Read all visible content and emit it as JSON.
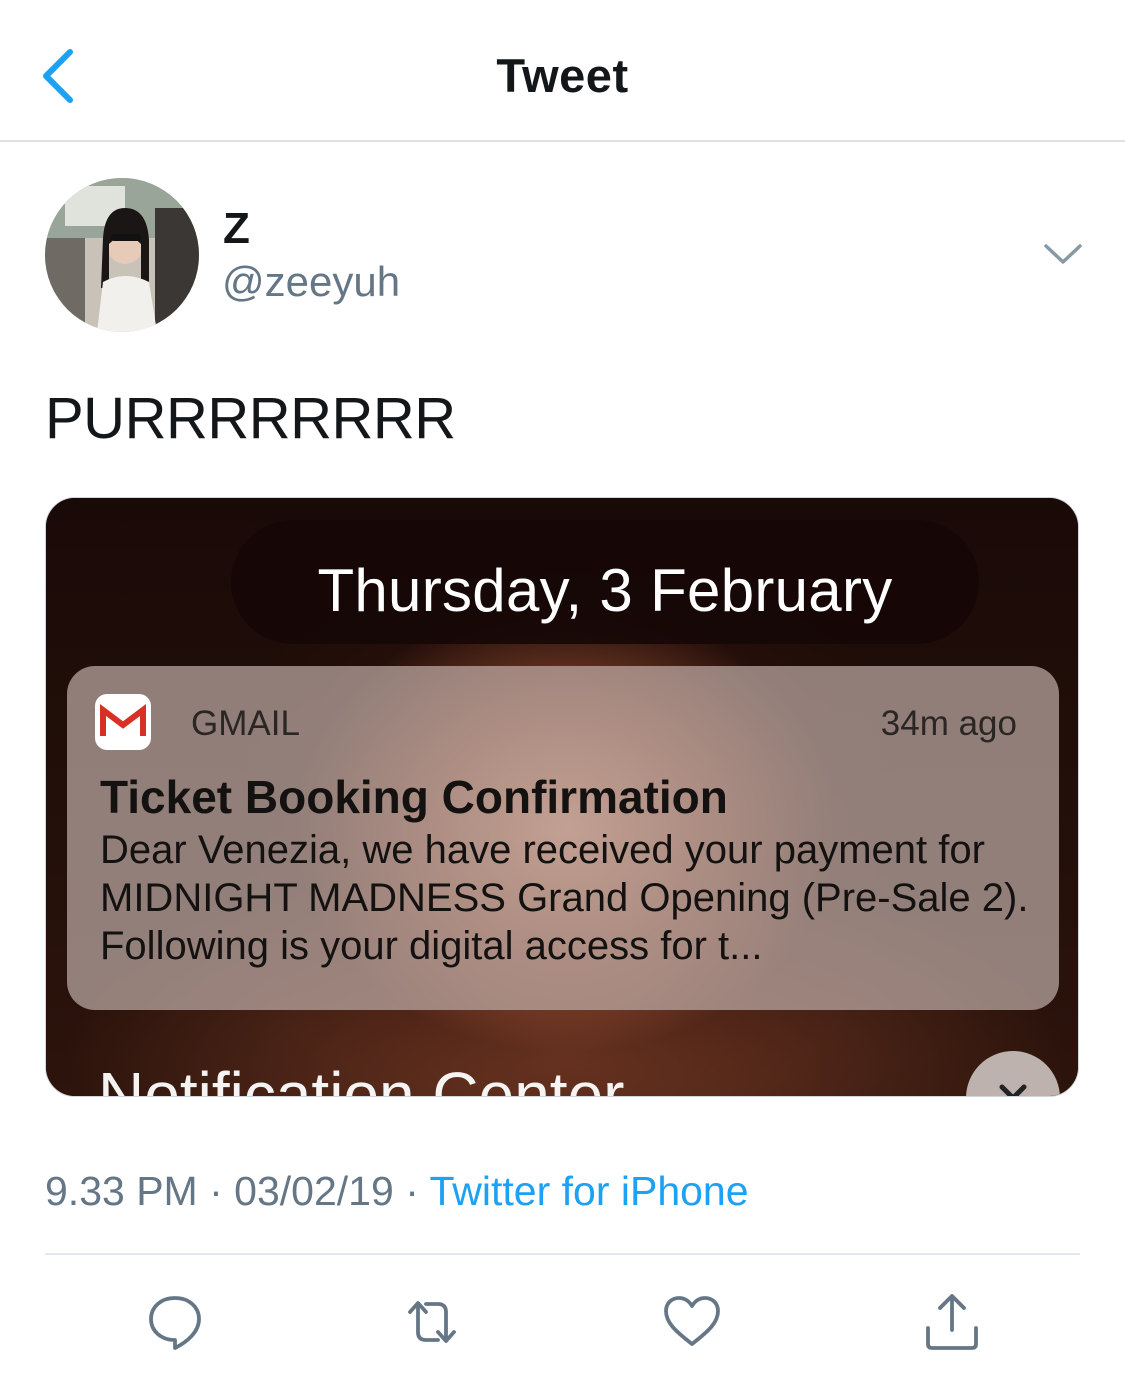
{
  "header": {
    "title": "Tweet"
  },
  "tweet": {
    "display_name": "Z",
    "handle": "@zeeyuh",
    "text": "PURRRRRRRR"
  },
  "media": {
    "date": "Thursday, 3 February",
    "notification": {
      "app_name": "GMAIL",
      "time": "34m ago",
      "title": "Ticket Booking Confirmation",
      "body": "Dear Venezia, we have received your payment for MIDNIGHT MADNESS Grand Opening (Pre-Sale 2). Following is your digital access for t..."
    },
    "notification_center_label": "Notification Center"
  },
  "meta": {
    "time": "9.33 PM",
    "separator": "·",
    "date": "03/02/19",
    "source": "Twitter for iPhone"
  },
  "colors": {
    "accent": "#1da1f2",
    "secondary_text": "#657786",
    "gmail_red": "#d93025"
  },
  "icons": {
    "back": "chevron-left-icon",
    "caret": "chevron-down-icon",
    "reply": "reply-icon",
    "retweet": "retweet-icon",
    "like": "heart-icon",
    "share": "share-icon"
  }
}
